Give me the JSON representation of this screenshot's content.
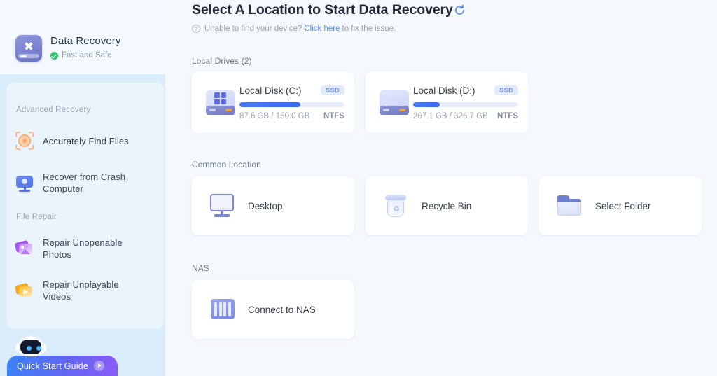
{
  "sidebar": {
    "brand": {
      "title": "Data Recovery",
      "subtitle": "Fast and Safe",
      "logo_icon": "wrench-screwdriver-icon",
      "shield_icon": "shield-check-icon"
    },
    "groups": [
      {
        "label": "Advanced Recovery",
        "items": [
          {
            "label": "Accurately Find Files",
            "icon": "target-scan-icon"
          },
          {
            "label": "Recover from Crash Computer",
            "icon": "monitor-icon"
          }
        ]
      },
      {
        "label": "File Repair",
        "items": [
          {
            "label": "Repair Unopenable Photos",
            "icon": "photo-icon"
          },
          {
            "label": "Repair Unplayable Videos",
            "icon": "video-icon"
          }
        ]
      }
    ],
    "quick_start": {
      "label": "Quick Start Guide",
      "arrow_icon": "play-circle-icon",
      "robot_icon": "robot-mascot-icon"
    }
  },
  "main": {
    "title": "Select A Location to Start Data Recovery",
    "refresh_icon": "refresh-icon",
    "help": {
      "question_icon": "question-mark-icon",
      "text_before": "Unable to find your device?",
      "link": "Click here",
      "text_after": "to fix the issue."
    },
    "sections": {
      "local_drives": {
        "label": "Local Drives (2)",
        "drives": [
          {
            "name": "Local Disk (C:)",
            "badge": "SSD",
            "usage": "87.6 GB / 150.0 GB",
            "filesystem": "NTFS",
            "fill_percent": 58,
            "icon": "hard-drive-windows-icon"
          },
          {
            "name": "Local Disk (D:)",
            "badge": "SSD",
            "usage": "267.1 GB / 326.7 GB",
            "filesystem": "NTFS",
            "fill_percent": 25,
            "icon": "hard-drive-icon"
          }
        ]
      },
      "common_location": {
        "label": "Common Location",
        "items": [
          {
            "label": "Desktop",
            "icon": "desktop-monitor-icon"
          },
          {
            "label": "Recycle Bin",
            "icon": "recycle-bin-icon"
          },
          {
            "label": "Select Folder",
            "icon": "folder-icon"
          }
        ]
      },
      "nas": {
        "label": "NAS",
        "items": [
          {
            "label": "Connect to NAS",
            "icon": "nas-server-icon"
          }
        ]
      }
    }
  },
  "colors": {
    "accent": "#3a6ae8",
    "sidebar_bg": "#d9ecfa",
    "panel_bg": "#eaf4fc",
    "link": "#5b8def",
    "safe_green": "#2fc36b"
  }
}
